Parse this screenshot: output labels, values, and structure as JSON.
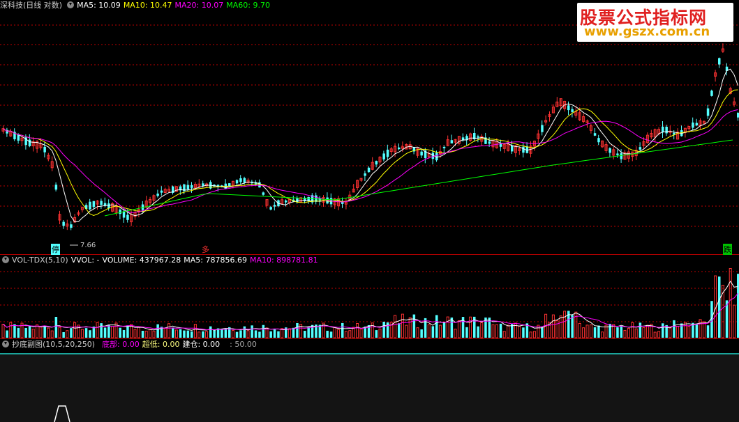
{
  "main_header": {
    "title": "深科技(日线 对数)",
    "ma5": "MA5: 10.09",
    "ma10": "MA10: 10.47",
    "ma20": "MA20: 10.07",
    "ma60": "MA60: 9.70"
  },
  "watermark": {
    "line1": "股票公式指标网",
    "line2": "www.gszx.com.cn"
  },
  "annotations": {
    "low_price": "7.66",
    "tag_left": "停",
    "tag_mid": "多",
    "tag_right": "跌"
  },
  "vol_header": {
    "title": "VOL-TDX(5,10)",
    "vvol": "VVOL: -",
    "volume": "VOLUME: 437967.28",
    "ma5": "MA5: 787856.69",
    "ma10": "MA10: 898781.81"
  },
  "ind_header": {
    "title": "抄底副图(10,5,20,250)",
    "bottom": "底部: 0.00",
    "super_low": "超低: 0.00",
    "build": "建仓: 0.00",
    "level": ": 50.00"
  },
  "colors": {
    "up": "#ff3232",
    "down": "#54ffff",
    "ma5": "#ffffff",
    "ma10": "#ffff00",
    "ma20": "#ff00ff",
    "ma60": "#00ff00",
    "grid": "#c00000"
  }
}
